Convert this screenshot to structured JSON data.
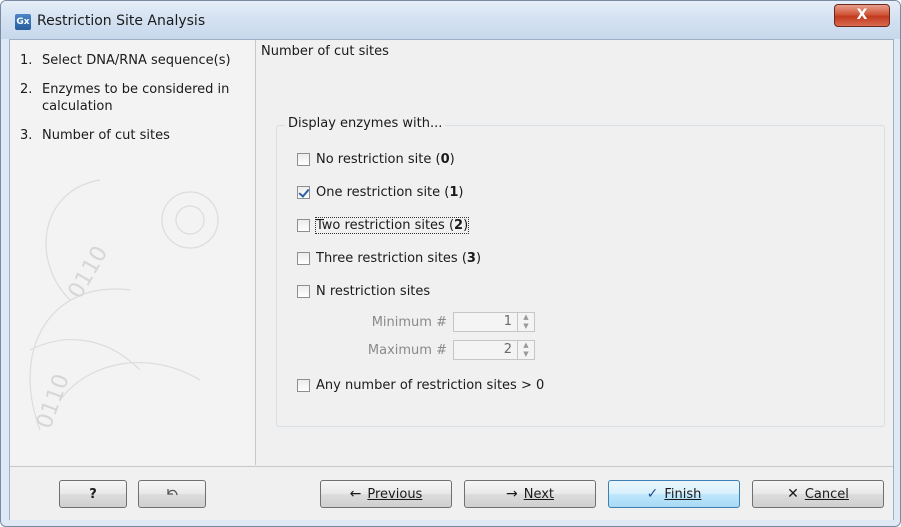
{
  "window": {
    "title": "Restriction Site Analysis",
    "app_icon": "Gx",
    "close_label": "X"
  },
  "steps": [
    {
      "num": "1.",
      "label": "Select DNA/RNA sequence(s)"
    },
    {
      "num": "2.",
      "label": "Enzymes to be considered in calculation"
    },
    {
      "num": "3.",
      "label": "Number of cut sites"
    }
  ],
  "main": {
    "section_title": "Number of cut sites",
    "group_label": "Display enzymes with...",
    "options": [
      {
        "label": "No restriction site",
        "count": "0",
        "checked": false
      },
      {
        "label": "One restriction site",
        "count": "1",
        "checked": true
      },
      {
        "label": "Two restriction sites",
        "count": "2",
        "checked": false
      },
      {
        "label": "Three restriction sites",
        "count": "3",
        "checked": false
      },
      {
        "label": "N restriction sites",
        "checked": false
      },
      {
        "label": "Any number of restriction sites > 0",
        "checked": false
      }
    ],
    "minimum_label": "Minimum #",
    "minimum_value": "1",
    "maximum_label": "Maximum #",
    "maximum_value": "2"
  },
  "footer": {
    "help_label": "?",
    "reset_icon": "undo-icon",
    "previous_label": "Previous",
    "next_label": "Next",
    "finish_label": "Finish",
    "cancel_label": "Cancel"
  },
  "colors": {
    "titlebar": "#d3e1f1",
    "close": "#c23a1e",
    "primary_button": "#bee6fd"
  }
}
